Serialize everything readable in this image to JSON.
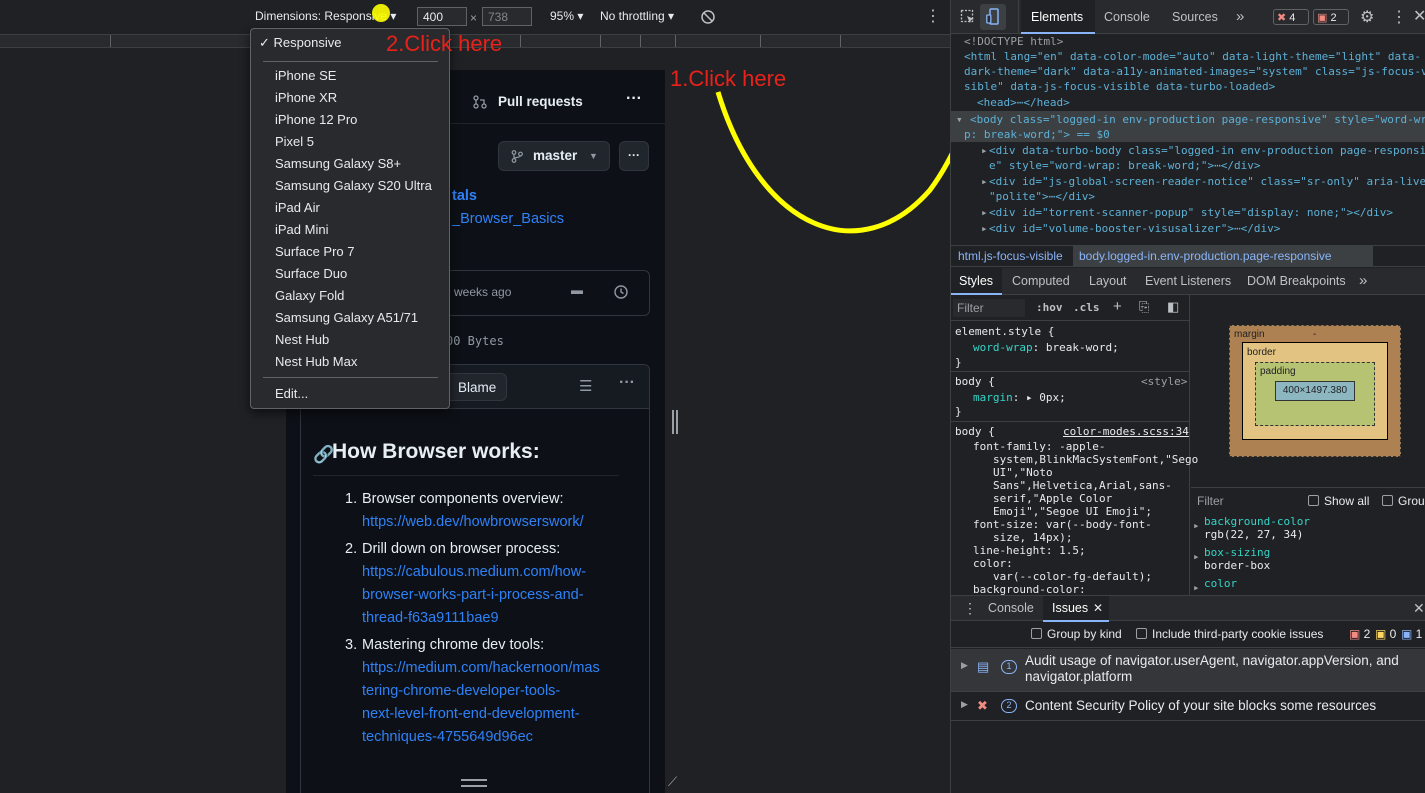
{
  "toolbar": {
    "dimensions_label": "Dimensions: Responsive ▾",
    "width_value": "400",
    "height_value": "738",
    "times": "×",
    "zoom": "95% ▾",
    "throttle": "No throttling ▾"
  },
  "dropdown": {
    "checked": "✓ Responsive",
    "devices": [
      "iPhone SE",
      "iPhone XR",
      "iPhone 12 Pro",
      "Pixel 5",
      "Samsung Galaxy S8+",
      "Samsung Galaxy S20 Ultra",
      "iPad Air",
      "iPad Mini",
      "Surface Pro 7",
      "Surface Duo",
      "Galaxy Fold",
      "Samsung Galaxy A51/71",
      "Nest Hub",
      "Nest Hub Max"
    ],
    "edit": "Edit..."
  },
  "annotations": {
    "step1": "1.Click here",
    "step2": "2.Click here"
  },
  "page": {
    "pull_requests": "Pull requests",
    "branch": "master",
    "link1": "tals",
    "link2": "_Browser_Basics",
    "commit_time": "weeks ago",
    "file_size": "00 Bytes",
    "blame": "Blame",
    "heading": "How Browser works:",
    "list": [
      {
        "num": "1.",
        "title": "Browser components overview:",
        "links": [
          "https://web.dev/howbrowserswork/"
        ]
      },
      {
        "num": "2.",
        "title": "Drill down on browser process:",
        "links": [
          "https://cabulous.medium.com/how-",
          "browser-works-part-i-process-and-",
          "thread-f63a9111bae9"
        ]
      },
      {
        "num": "3.",
        "title": "Mastering chrome dev tools:",
        "links": [
          "https://medium.com/hackernoon/mas",
          "tering-chrome-developer-tools-",
          "next-level-front-end-development-",
          "techniques-4755649d96ec"
        ]
      }
    ]
  },
  "devtools": {
    "tabs": [
      "Elements",
      "Console",
      "Sources",
      "»"
    ],
    "badge_errors": "4",
    "badge_warnings": "2",
    "dom_lines": [
      "<!DOCTYPE html>",
      "<html lang=\"en\" data-color-mode=\"auto\" data-light-theme=\"light\" data-",
      "dark-theme=\"dark\" data-a11y-animated-images=\"system\" class=\"js-focus-vi",
      "sible\" data-js-focus-visible data-turbo-loaded>",
      "<head>⋯</head>",
      "<body class=\"logged-in env-production page-responsive\" style=\"word-wra",
      "p: break-word;\"> == $0",
      "<div data-turbo-body class=\"logged-in env-production page-responsi",
      "e\" style=\"word-wrap: break-word;\">⋯</div>",
      "<div id=\"js-global-screen-reader-notice\" class=\"sr-only\" aria-live",
      "\"polite\">⋯</div>",
      "<div id=\"torrent-scanner-popup\" style=\"display: none;\"></div>",
      "<div id=\"volume-booster-visusalizer\">⋯</div>"
    ],
    "breadcrumb": [
      "html.js-focus-visible",
      "body.logged-in.env-production.page-responsive"
    ],
    "style_tabs": [
      "Styles",
      "Computed",
      "Layout",
      "Event Listeners",
      "DOM Breakpoints",
      "»"
    ],
    "filter_placeholder": "Filter",
    "hov": ":hov",
    "cls": ".cls",
    "rule1_selector": "element.style {",
    "rule1_decl": "word-wrap: break-word;",
    "rule2_selector": "body {",
    "rule2_source": "<style>",
    "rule2_decl": "margin: ▸ 0px;",
    "rule3_selector": "body {",
    "rule3_source": "color-modes.scss:34",
    "rule3_lines": [
      "font-family: -apple-",
      "system,BlinkMacSystemFont,\"Sego",
      "UI\",\"Noto",
      "Sans\",Helvetica,Arial,sans-",
      "serif,\"Apple Color",
      "Emoji\",\"Segoe UI Emoji\";",
      "font-size: var(--body-font-",
      "size, 14px);",
      "line-height: 1.5;",
      "color:",
      "var(--color-fg-default);",
      "background-color:"
    ],
    "box_model": {
      "margin": "margin",
      "border": "border",
      "padding": "padding",
      "content": "400×1497.380",
      "dash": "-"
    },
    "computed_filter": "Filter",
    "show_all": "Show all",
    "group": "Grou",
    "computed": [
      {
        "prop": "background-color",
        "val": "rgb(22, 27, 34)"
      },
      {
        "prop": "box-sizing",
        "val": "border-box"
      },
      {
        "prop": "color",
        "val": ""
      }
    ],
    "drawer_tabs": [
      "Console",
      "Issues"
    ],
    "group_by_kind": "Group by kind",
    "third_party": "Include third-party cookie issues",
    "drawer_counts": [
      "2",
      "0",
      "1"
    ],
    "issues": [
      {
        "count": "1",
        "text": "Audit usage of navigator.userAgent, navigator.appVersion, and navigator.platform"
      },
      {
        "count": "2",
        "text": "Content Security Policy of your site blocks some resources"
      }
    ],
    "colors": {
      "accent": "#8ab4f8",
      "error": "#e8221a",
      "annotation": "#ffff00"
    }
  }
}
